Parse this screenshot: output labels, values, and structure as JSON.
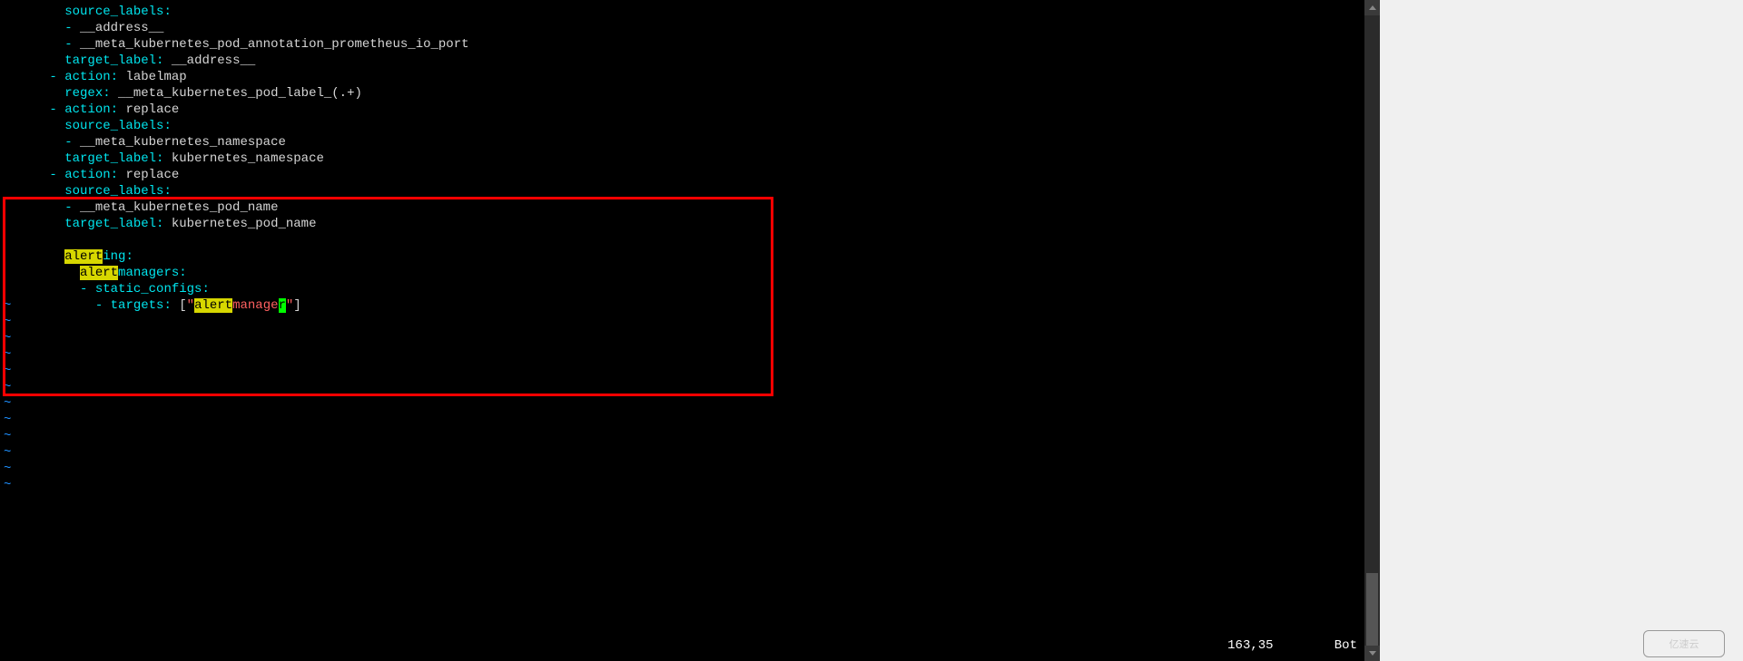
{
  "lines": [
    {
      "indent": "        ",
      "key": "source_labels",
      "colon": ":",
      "val": ""
    },
    {
      "indent": "        ",
      "dash": "- ",
      "val": "__address__"
    },
    {
      "indent": "        ",
      "dash": "- ",
      "val": "__meta_kubernetes_pod_annotation_prometheus_io_port"
    },
    {
      "indent": "        ",
      "key": "target_label",
      "colon": ": ",
      "val": "__address__"
    },
    {
      "indent": "      ",
      "dash": "- ",
      "key": "action",
      "colon": ": ",
      "val": "labelmap"
    },
    {
      "indent": "        ",
      "key": "regex",
      "colon": ": ",
      "val": "__meta_kubernetes_pod_label_(.+)"
    },
    {
      "indent": "      ",
      "dash": "- ",
      "key": "action",
      "colon": ": ",
      "val": "replace"
    },
    {
      "indent": "        ",
      "key": "source_labels",
      "colon": ":",
      "val": ""
    },
    {
      "indent": "        ",
      "dash": "- ",
      "val": "__meta_kubernetes_namespace"
    },
    {
      "indent": "        ",
      "key": "target_label",
      "colon": ": ",
      "val": "kubernetes_namespace"
    },
    {
      "indent": "      ",
      "dash": "- ",
      "key": "action",
      "colon": ": ",
      "val": "replace"
    },
    {
      "indent": "        ",
      "key": "source_labels",
      "colon": ":",
      "val": ""
    },
    {
      "indent": "        ",
      "dash": "- ",
      "val": "__meta_kubernetes_pod_name"
    },
    {
      "indent": "        ",
      "key": "target_label",
      "colon": ": ",
      "val": "kubernetes_pod_name"
    }
  ],
  "alerting": {
    "l1_hl": "alert",
    "l1_rest": "ing",
    "l1_colon": ":",
    "l2_indent": "  ",
    "l2_hl": "alert",
    "l2_rest": "managers",
    "l2_colon": ":",
    "l3_indent": "  ",
    "l3_dash": "- ",
    "l3_key": "static_configs",
    "l3_colon": ":",
    "l4_indent": "    ",
    "l4_dash": "- ",
    "l4_key": "targets",
    "l4_colon": ": ",
    "l4_br_open": "[",
    "l4_q1": "\"",
    "l4_hl1": "alert",
    "l4_mid": "manage",
    "l4_cursor": "r",
    "l4_q2": "\"",
    "l4_br_close": "]"
  },
  "tilde_count": 12,
  "tilde_char": "~",
  "status": {
    "pos": "163,35",
    "loc": "Bot"
  },
  "watermark": "亿速云"
}
